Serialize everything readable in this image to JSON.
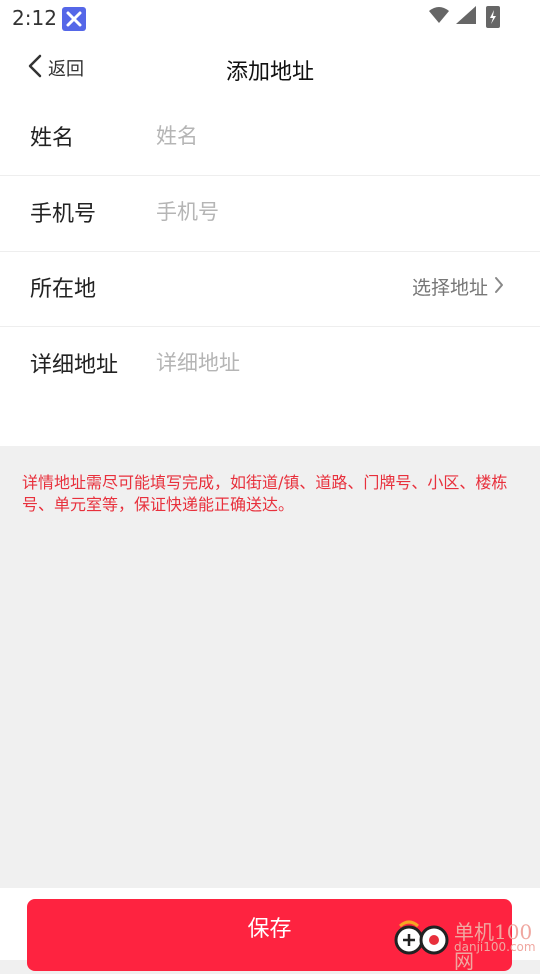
{
  "status_bar": {
    "time": "2:12"
  },
  "header": {
    "back_label": "返回",
    "title": "添加地址"
  },
  "form": {
    "name": {
      "label": "姓名",
      "placeholder": "姓名"
    },
    "phone": {
      "label": "手机号",
      "placeholder": "手机号"
    },
    "location": {
      "label": "所在地",
      "picker_text": "选择地址"
    },
    "detail": {
      "label": "详细地址",
      "placeholder": "详细地址"
    }
  },
  "tip": "详情地址需尽可能填写完成，如街道/镇、道路、门牌号、小区、楼栋号、单元室等，保证快递能正确送达。",
  "save_label": "保存",
  "watermark": {
    "title": "单机100网",
    "subtitle": "danji100.com"
  },
  "colors": {
    "accent": "#fe2340",
    "tip_text": "#e8303c",
    "background": "#f0f0f0"
  }
}
